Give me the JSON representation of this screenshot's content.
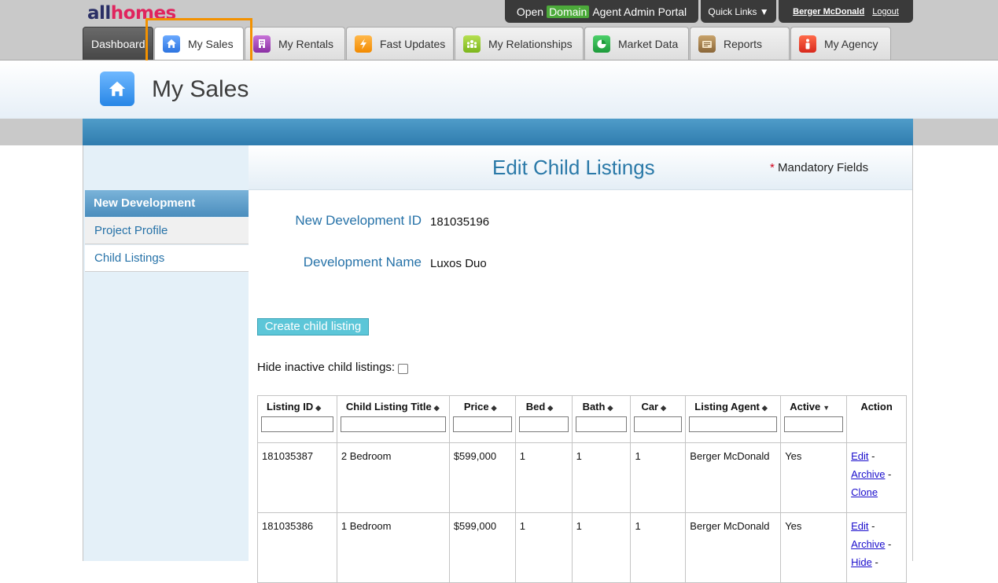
{
  "logo": {
    "part1": "all",
    "part2": "homes"
  },
  "portal": {
    "open_prefix": "Open",
    "domain": "Domain",
    "open_suffix": "Agent Admin Portal",
    "quick_links": "Quick Links ▼",
    "user_name": "Berger McDonald",
    "logout": "Logout"
  },
  "tabs": [
    {
      "label": "Dashboard"
    },
    {
      "label": "My Sales",
      "icon": "home-icon"
    },
    {
      "label": "My Rentals",
      "icon": "building-icon"
    },
    {
      "label": "Fast Updates",
      "icon": "lightning-icon"
    },
    {
      "label": "My Relationships",
      "icon": "people-icon"
    },
    {
      "label": "Market Data",
      "icon": "pie-chart-icon"
    },
    {
      "label": "Reports",
      "icon": "reports-icon"
    },
    {
      "label": "My Agency",
      "icon": "agency-icon"
    }
  ],
  "header": {
    "title": "My Sales"
  },
  "sidebar": {
    "section": "New Development",
    "items": [
      {
        "label": "Project Profile"
      },
      {
        "label": "Child Listings"
      }
    ]
  },
  "main": {
    "title": "Edit Child Listings",
    "mandatory_star": "*",
    "mandatory_label": "Mandatory Fields",
    "fields": [
      {
        "label": "New Development ID",
        "value": "181035196"
      },
      {
        "label": "Development Name",
        "value": "Luxos Duo"
      }
    ],
    "create_button": "Create child listing",
    "hide_inactive_label": "Hide inactive child listings:"
  },
  "table": {
    "columns": [
      {
        "label": "Listing ID",
        "sort": "◆"
      },
      {
        "label": "Child Listing Title",
        "sort": "◆"
      },
      {
        "label": "Price",
        "sort": "◆"
      },
      {
        "label": "Bed",
        "sort": "◆"
      },
      {
        "label": "Bath",
        "sort": "◆"
      },
      {
        "label": "Car",
        "sort": "◆"
      },
      {
        "label": "Listing Agent",
        "sort": "◆"
      },
      {
        "label": "Active",
        "sort": "▼"
      },
      {
        "label": "Action"
      }
    ],
    "rows": [
      {
        "id": "181035387",
        "title": "2 Bedroom",
        "price": "$599,000",
        "bed": "1",
        "bath": "1",
        "car": "1",
        "agent": "Berger McDonald",
        "active": "Yes",
        "actions": [
          "Edit",
          "Archive",
          "Clone"
        ],
        "sep": " -"
      },
      {
        "id": "181035386",
        "title": "1 Bedroom",
        "price": "$599,000",
        "bed": "1",
        "bath": "1",
        "car": "1",
        "agent": "Berger McDonald",
        "active": "Yes",
        "actions": [
          "Edit",
          "Archive",
          "Hide"
        ],
        "sep": " -"
      }
    ]
  },
  "colors": {
    "accent": "#2a79a8",
    "highlight": "#f29100",
    "button": "#5cc6d8"
  }
}
